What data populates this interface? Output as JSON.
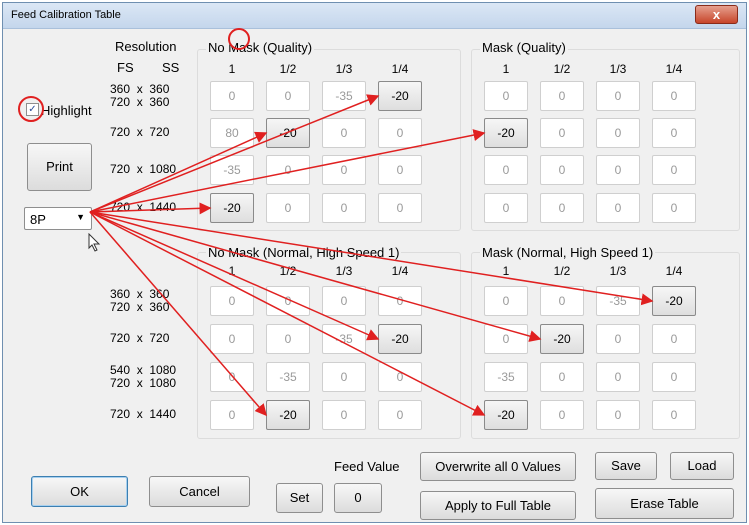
{
  "window": {
    "title": "Feed Calibration Table",
    "close_glyph": "x"
  },
  "resolution": {
    "label": "Resolution",
    "fs_label": "FS",
    "ss_label": "SS"
  },
  "left": {
    "highlight_label": "Highlight",
    "highlight_checked": true,
    "print_label": "Print",
    "combo_value": "8P"
  },
  "top_rows": [
    {
      "line1": "360  x  360",
      "line2": "720  x  360"
    },
    {
      "line1": "720  x  720",
      "line2": ""
    },
    {
      "line1": "720  x  1080",
      "line2": ""
    },
    {
      "line1": "720  x  1440",
      "line2": ""
    }
  ],
  "bottom_rows": [
    {
      "line1": "360  x  360",
      "line2": "720  x  360"
    },
    {
      "line1": "720  x  720",
      "line2": ""
    },
    {
      "line1": "540  x  1080",
      "line2": "720  x  1080"
    },
    {
      "line1": "720  x  1440",
      "line2": ""
    }
  ],
  "columns": [
    "1",
    "1/2",
    "1/3",
    "1/4"
  ],
  "groups": [
    {
      "title": "No Mask (Quality)",
      "values": [
        [
          "0",
          "0",
          "-35",
          "-20"
        ],
        [
          "80",
          "-20",
          "0",
          "0"
        ],
        [
          "-35",
          "0",
          "0",
          "0"
        ],
        [
          "-20",
          "0",
          "0",
          "0"
        ]
      ],
      "active": [
        [
          0,
          3
        ],
        [
          1,
          1
        ],
        [
          3,
          0
        ]
      ]
    },
    {
      "title": "Mask (Quality)",
      "values": [
        [
          "0",
          "0",
          "0",
          "0"
        ],
        [
          "-20",
          "0",
          "0",
          "0"
        ],
        [
          "0",
          "0",
          "0",
          "0"
        ],
        [
          "0",
          "0",
          "0",
          "0"
        ]
      ],
      "active": [
        [
          1,
          0
        ]
      ]
    },
    {
      "title": "No Mask (Normal, High Speed 1)",
      "values": [
        [
          "0",
          "0",
          "0",
          "0"
        ],
        [
          "0",
          "0",
          "-35",
          "-20"
        ],
        [
          "0",
          "-35",
          "0",
          "0"
        ],
        [
          "0",
          "-20",
          "0",
          "0"
        ]
      ],
      "active": [
        [
          1,
          3
        ],
        [
          3,
          1
        ]
      ]
    },
    {
      "title": "Mask (Normal, High Speed 1)",
      "values": [
        [
          "0",
          "0",
          "-35",
          "-20"
        ],
        [
          "0",
          "-20",
          "0",
          "0"
        ],
        [
          "-35",
          "0",
          "0",
          "0"
        ],
        [
          "-20",
          "0",
          "0",
          "0"
        ]
      ],
      "active": [
        [
          0,
          3
        ],
        [
          1,
          1
        ],
        [
          3,
          0
        ]
      ]
    }
  ],
  "footer": {
    "ok": "OK",
    "cancel": "Cancel",
    "feed_value_label": "Feed Value",
    "set": "Set",
    "feed_value": "0",
    "overwrite": "Overwrite all 0 Values",
    "apply": "Apply to Full Table",
    "save": "Save",
    "load": "Load",
    "erase": "Erase Table"
  },
  "colors": {
    "annotation": "#e02020",
    "accent": "#3c7fb1"
  }
}
